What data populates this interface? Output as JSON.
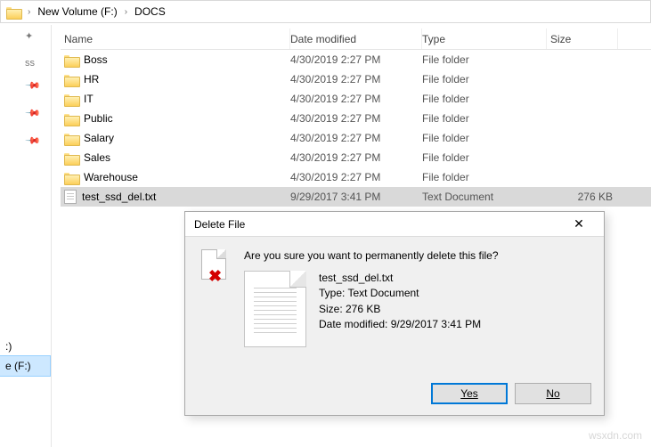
{
  "breadcrumb": {
    "segments": [
      "New Volume (F:)",
      "DOCS"
    ]
  },
  "columns": {
    "name": "Name",
    "date": "Date modified",
    "type": "Type",
    "size": "Size"
  },
  "rows": [
    {
      "name": "Boss",
      "date": "4/30/2019 2:27 PM",
      "type": "File folder",
      "size": "",
      "kind": "folder",
      "selected": false
    },
    {
      "name": "HR",
      "date": "4/30/2019 2:27 PM",
      "type": "File folder",
      "size": "",
      "kind": "folder",
      "selected": false
    },
    {
      "name": "IT",
      "date": "4/30/2019 2:27 PM",
      "type": "File folder",
      "size": "",
      "kind": "folder",
      "selected": false
    },
    {
      "name": "Public",
      "date": "4/30/2019 2:27 PM",
      "type": "File folder",
      "size": "",
      "kind": "folder",
      "selected": false
    },
    {
      "name": "Salary",
      "date": "4/30/2019 2:27 PM",
      "type": "File folder",
      "size": "",
      "kind": "folder",
      "selected": false
    },
    {
      "name": "Sales",
      "date": "4/30/2019 2:27 PM",
      "type": "File folder",
      "size": "",
      "kind": "folder",
      "selected": false
    },
    {
      "name": "Warehouse",
      "date": "4/30/2019 2:27 PM",
      "type": "File folder",
      "size": "",
      "kind": "folder",
      "selected": false
    },
    {
      "name": "test_ssd_del.txt",
      "date": "9/29/2017 3:41 PM",
      "type": "Text Document",
      "size": "276 KB",
      "kind": "txt",
      "selected": true
    }
  ],
  "sidebar": {
    "drives": [
      ":)",
      "e (F:)"
    ],
    "selected_index": 1
  },
  "dialog": {
    "title": "Delete File",
    "prompt": "Are you sure you want to permanently delete this file?",
    "file_name": "test_ssd_del.txt",
    "type_line": "Type: Text Document",
    "size_line": "Size: 276 KB",
    "date_line": "Date modified: 9/29/2017 3:41 PM",
    "yes": "Yes",
    "no": "No"
  },
  "watermark": "wsxdn.com"
}
